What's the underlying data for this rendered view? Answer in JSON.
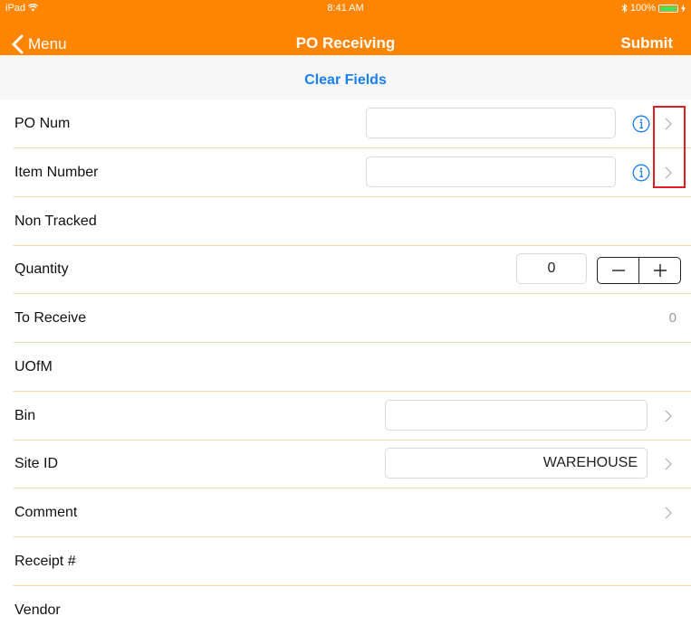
{
  "status_bar": {
    "device": "iPad",
    "wifi_icon": "wifi-icon",
    "time": "8:41 AM",
    "bluetooth_icon": "bluetooth-icon",
    "battery": "100%",
    "battery_icon": "battery-icon",
    "charging_icon": "charging-bolt-icon"
  },
  "nav": {
    "back_label": "Menu",
    "back_icon": "chevron-left-icon",
    "title": "PO Receiving",
    "submit_label": "Submit"
  },
  "clear_fields_label": "Clear Fields",
  "colors": {
    "accent": "#ff8503",
    "link": "#1a7ef5",
    "separator": "#f4d7a8",
    "highlight": "#e01b24"
  },
  "form": {
    "po_num": {
      "label": "PO Num",
      "value": "",
      "info_icon": "info-icon",
      "disclosure_icon": "chevron-right-icon"
    },
    "item_number": {
      "label": "Item Number",
      "value": "",
      "info_icon": "info-icon",
      "disclosure_icon": "chevron-right-icon"
    },
    "non_tracked": {
      "label": "Non Tracked"
    },
    "quantity": {
      "label": "Quantity",
      "value": "0",
      "decrement_icon": "minus-icon",
      "increment_icon": "plus-icon"
    },
    "to_receive": {
      "label": "To Receive",
      "value": "0"
    },
    "uofm": {
      "label": "UOfM"
    },
    "bin": {
      "label": "Bin",
      "value": "",
      "disclosure_icon": "chevron-right-icon"
    },
    "site_id": {
      "label": "Site ID",
      "value": "WAREHOUSE",
      "disclosure_icon": "chevron-right-icon"
    },
    "comment": {
      "label": "Comment",
      "disclosure_icon": "chevron-right-icon"
    },
    "receipt": {
      "label": "Receipt #"
    },
    "vendor": {
      "label": "Vendor"
    }
  }
}
